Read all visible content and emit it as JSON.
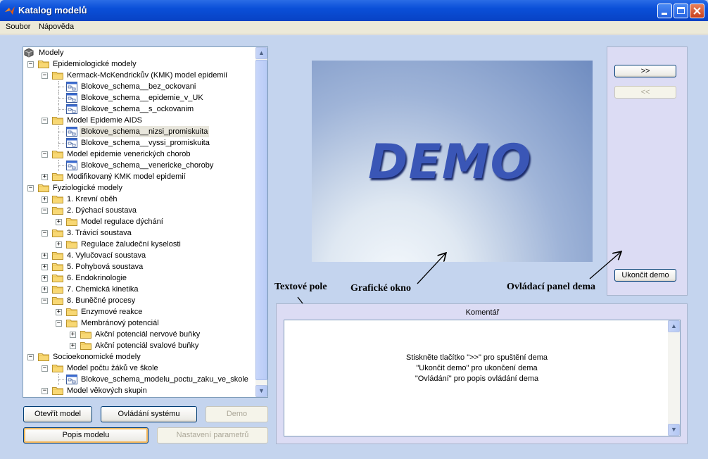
{
  "window": {
    "title": "Katalog modelů"
  },
  "menu": [
    {
      "label": "Soubor"
    },
    {
      "label": "Nápověda"
    }
  ],
  "tree": {
    "items": [
      {
        "label": "Modely",
        "level": 0,
        "type": "root"
      },
      {
        "label": "Epidemiologické modely",
        "level": 1,
        "type": "folder",
        "expanded": true
      },
      {
        "label": "Kermack-McKendrickův (KMK) model epidemií",
        "level": 2,
        "type": "folder",
        "expanded": true
      },
      {
        "label": "Blokove_schema__bez_ockovani",
        "level": 3,
        "type": "model"
      },
      {
        "label": "Blokove_schema__epidemie_v_UK",
        "level": 3,
        "type": "model"
      },
      {
        "label": "Blokove_schema__s_ockovanim",
        "level": 3,
        "type": "model"
      },
      {
        "label": "Model Epidemie AIDS",
        "level": 2,
        "type": "folder",
        "expanded": true
      },
      {
        "label": "Blokove_schema__nizsi_promiskuita",
        "level": 3,
        "type": "model",
        "selected": true
      },
      {
        "label": "Blokove_schema__vyssi_promiskuita",
        "level": 3,
        "type": "model"
      },
      {
        "label": "Model epidemie venerických chorob",
        "level": 2,
        "type": "folder",
        "expanded": true
      },
      {
        "label": "Blokove_schema__venericke_choroby",
        "level": 3,
        "type": "model"
      },
      {
        "label": "Modifikovaný KMK model epidemií",
        "level": 2,
        "type": "folder",
        "expanded": false
      },
      {
        "label": "Fyziologické modely",
        "level": 1,
        "type": "folder",
        "expanded": true
      },
      {
        "label": "1. Krevní oběh",
        "level": 2,
        "type": "folder",
        "expanded": false
      },
      {
        "label": "2. Dýchací soustava",
        "level": 2,
        "type": "folder",
        "expanded": true
      },
      {
        "label": "Model regulace dýchání",
        "level": 3,
        "type": "folder",
        "expanded": false
      },
      {
        "label": "3. Trávicí soustava",
        "level": 2,
        "type": "folder",
        "expanded": true
      },
      {
        "label": "Regulace žaludeční kyselosti",
        "level": 3,
        "type": "folder",
        "expanded": false
      },
      {
        "label": "4. Vylučovací soustava",
        "level": 2,
        "type": "folder",
        "expanded": false
      },
      {
        "label": "5. Pohybová soustava",
        "level": 2,
        "type": "folder",
        "expanded": false
      },
      {
        "label": "6. Endokrinologie",
        "level": 2,
        "type": "folder",
        "expanded": false
      },
      {
        "label": "7. Chemická kinetika",
        "level": 2,
        "type": "folder",
        "expanded": false
      },
      {
        "label": "8. Buněčné procesy",
        "level": 2,
        "type": "folder",
        "expanded": true
      },
      {
        "label": "Enzymové reakce",
        "level": 3,
        "type": "folder",
        "expanded": false
      },
      {
        "label": "Membránový potenciál",
        "level": 3,
        "type": "folder",
        "expanded": true
      },
      {
        "label": "Akční potenciál nervové buňky",
        "level": 4,
        "type": "folder",
        "expanded": false
      },
      {
        "label": "Akční potenciál svalové buňky",
        "level": 4,
        "type": "folder",
        "expanded": false
      },
      {
        "label": "Socioekonomické modely",
        "level": 1,
        "type": "folder",
        "expanded": true
      },
      {
        "label": "Model počtu žáků ve škole",
        "level": 2,
        "type": "folder",
        "expanded": true
      },
      {
        "label": "Blokove_schema_modelu_poctu_zaku_ve_skole",
        "level": 3,
        "type": "model"
      },
      {
        "label": "Model věkových skupin",
        "level": 2,
        "type": "folder",
        "expanded": true
      }
    ]
  },
  "buttons": {
    "open_model": "Otevřít model",
    "system_controls": "Ovládání systému",
    "demo": "Demo",
    "model_description": "Popis modelu",
    "parameter_settings": "Nastavení parametrů",
    "next": ">>",
    "prev": "<<",
    "end_demo": "Ukončit demo"
  },
  "graphic": {
    "text": "DEMO"
  },
  "annotations": {
    "text_field": "Textové pole",
    "graphic_window": "Grafické okno",
    "control_panel": "Ovládací panel dema"
  },
  "comment": {
    "title": "Komentář",
    "lines": [
      "Stiskněte tlačítko \">>\" pro spuštění dema",
      "\"Ukončit demo\" pro ukončení dema",
      "\"Ovládání\" pro popis ovládání dema"
    ]
  },
  "colors": {
    "titlebar": "#0a4fd8",
    "panel": "#dcdcf4",
    "window_bg": "#c4d4ee"
  }
}
